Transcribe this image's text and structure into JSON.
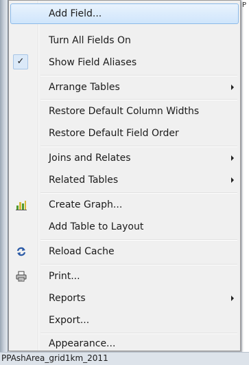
{
  "menu": {
    "items": [
      {
        "label": "Add Field...",
        "icon": "",
        "highlighted": true
      },
      {
        "label": "Turn All Fields On"
      },
      {
        "label": "Show Field Aliases",
        "checked": true,
        "icon": "checkmark-icon"
      },
      {
        "label": "Arrange Tables",
        "submenu": true
      },
      {
        "label": "Restore Default Column Widths"
      },
      {
        "label": "Restore Default Field Order"
      },
      {
        "label": "Joins and Relates",
        "submenu": true
      },
      {
        "label": "Related Tables",
        "submenu": true
      },
      {
        "label": "Create Graph...",
        "icon": "bar-graph-icon"
      },
      {
        "label": "Add Table to Layout"
      },
      {
        "label": "Reload Cache",
        "icon": "refresh-icon"
      },
      {
        "label": "Print...",
        "icon": "printer-icon"
      },
      {
        "label": "Reports",
        "submenu": true
      },
      {
        "label": "Export..."
      },
      {
        "label": "Appearance..."
      }
    ]
  },
  "checkmark_glyph": "✓",
  "status": {
    "layer_name": "PPAshArea_grid1km_2011"
  },
  "backdrop": {
    "fragment": "P"
  },
  "colors": {
    "menu_background": "#f0f0f0",
    "highlight_border": "#8ab9e8",
    "highlight_fill": "#cfe5fb",
    "graph_bar_green": "#4f9a2e",
    "graph_bar_yellow": "#d8b93a"
  }
}
